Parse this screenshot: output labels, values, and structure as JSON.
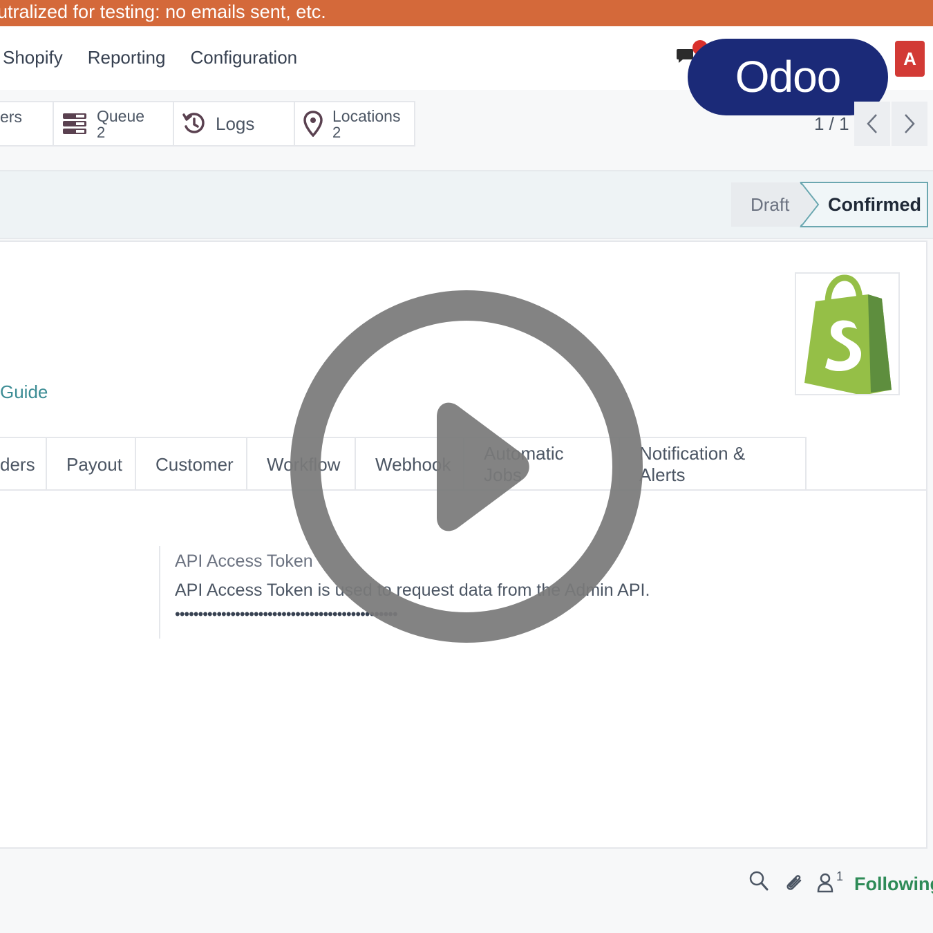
{
  "banner": {
    "text": "utralized for testing: no emails sent, etc."
  },
  "topnav": {
    "menu": [
      "Shopify",
      "Reporting",
      "Configuration"
    ],
    "brand": "Odoo",
    "avatar": "A"
  },
  "smart_buttons": {
    "partial": "ers",
    "queue": {
      "label": "Queue",
      "count": "2"
    },
    "logs": {
      "label": "Logs"
    },
    "locations": {
      "label": "Locations",
      "count": "2"
    }
  },
  "pager": {
    "text": "1 / 1"
  },
  "status": {
    "draft": "Draft",
    "confirmed": "Confirmed"
  },
  "form": {
    "guide_link": "Guide"
  },
  "tabs": [
    "ders",
    "Payout",
    "Customer",
    "Workflow",
    "Webhook",
    "Automatic Jobs",
    "Notification & Alerts"
  ],
  "field": {
    "label": "API Access Token",
    "help": "API Access Token is used to request data from the Admin API.",
    "value": "••••••••••••••••••••••••••••••••••••••••••••••••"
  },
  "chatter": {
    "followers_count": "1",
    "following": "Following"
  },
  "colors": {
    "banner": "#d4693a",
    "brand": "#1b2a78",
    "accent": "#3b8c94",
    "following": "#2e8b57",
    "avatar": "#d23a35",
    "shopify_green": "#95bf47"
  },
  "icons": [
    "chat-icon",
    "queue-icon",
    "logs-icon",
    "location-pin-icon",
    "chevron-left-icon",
    "chevron-right-icon",
    "shopify-logo",
    "search-icon",
    "paperclip-icon",
    "user-icon",
    "play-icon"
  ]
}
